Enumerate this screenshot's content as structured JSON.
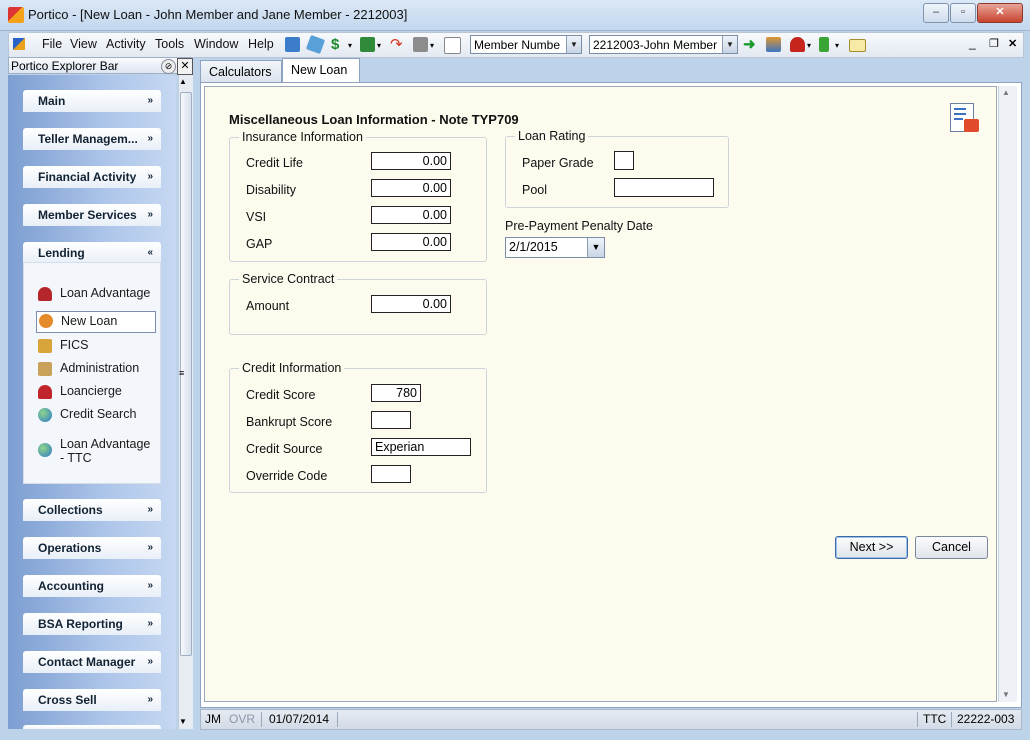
{
  "window": {
    "title": "Portico - [New Loan - John Member and Jane Member - 2212003]",
    "minimize": "–",
    "restore": "▫",
    "close": "✕"
  },
  "menu": {
    "items": [
      "File",
      "View",
      "Activity",
      "Tools",
      "Window",
      "Help"
    ],
    "search_type": "Member Numbe",
    "member_select": "2212003-John Member",
    "mdi_minimize": "_",
    "mdi_restore": "❐",
    "mdi_close": "✕"
  },
  "explorer": {
    "title": "Portico Explorer Bar",
    "sections_top": [
      "Main",
      "Teller Managem...",
      "Financial Activity",
      "Member Services"
    ],
    "lending": {
      "label": "Lending",
      "items": [
        "Loan Advantage",
        "New Loan",
        "FICS",
        "Administration",
        "Loancierge",
        "Credit Search",
        "Loan Advantage - TTC"
      ]
    },
    "sections_bottom": [
      "Collections",
      "Operations",
      "Accounting",
      "BSA Reporting",
      "Contact Manager",
      "Cross Sell"
    ]
  },
  "tabs": [
    "Calculators",
    "New Loan"
  ],
  "form": {
    "heading": "Miscellaneous Loan Information - Note TYP709",
    "insurance": {
      "title": "Insurance Information",
      "credit_life_label": "Credit Life",
      "credit_life": "0.00",
      "disability_label": "Disability",
      "disability": "0.00",
      "vsi_label": "VSI",
      "vsi": "0.00",
      "gap_label": "GAP",
      "gap": "0.00"
    },
    "service_contract": {
      "title": "Service Contract",
      "amount_label": "Amount",
      "amount": "0.00"
    },
    "credit": {
      "title": "Credit Information",
      "score_label": "Credit Score",
      "score": "780",
      "bankrupt_label": "Bankrupt Score",
      "bankrupt": "",
      "source_label": "Credit Source",
      "source": "Experian",
      "override_label": "Override Code",
      "override": ""
    },
    "loan_rating": {
      "title": "Loan Rating",
      "paper_grade_label": "Paper Grade",
      "paper_grade": "",
      "pool_label": "Pool",
      "pool": ""
    },
    "prepayment": {
      "label": "Pre-Payment Penalty Date",
      "value": "2/1/2015"
    },
    "next_button": "Next >>",
    "cancel_button": "Cancel"
  },
  "status": {
    "user": "JM",
    "ovr": "OVR",
    "date": "01/07/2014",
    "mode": "TTC",
    "branch": "22222-003"
  },
  "colors": {
    "form_bg": "#fdfaee",
    "explorer_gradient": "#7c9ed1",
    "title_bar": "#c3d7ee"
  }
}
